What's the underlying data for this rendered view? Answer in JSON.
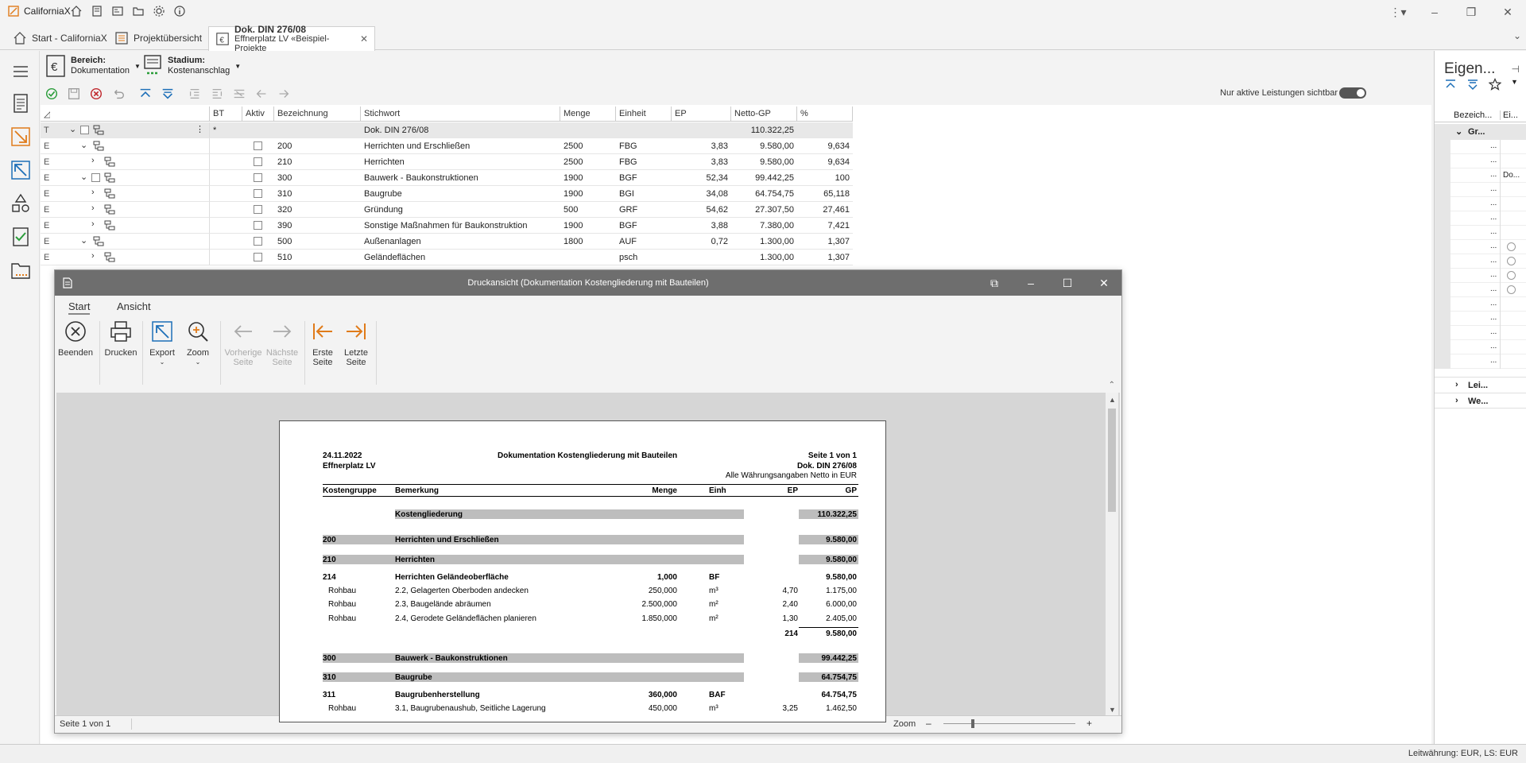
{
  "app": {
    "title": "CaliforniaX",
    "tabs": [
      {
        "label": "Start - CaliforniaX"
      },
      {
        "label": "Projektübersicht"
      },
      {
        "title": "Dok. DIN 276/08",
        "subtitle": "Effnerplatz LV «Beispiel-Projekte"
      }
    ]
  },
  "ribbon": {
    "bereich_label": "Bereich:",
    "bereich_value": "Dokumentation",
    "stadium_label": "Stadium:",
    "stadium_value": "Kostenanschlag",
    "toggle_label": "Nur aktive Leistungen sichtbar",
    "toggle_on": true
  },
  "grid": {
    "headers": [
      "BT",
      "Aktiv",
      "Bezeichnung",
      "Stichwort",
      "Menge",
      "Einheit",
      "EP",
      "Netto-GP",
      "%"
    ],
    "rows": [
      {
        "type": "T",
        "bt": "*",
        "bez": "",
        "stich": "Dok. DIN 276/08",
        "menge": "",
        "einheit": "",
        "ep": "",
        "netto": "110.322,25",
        "pct": ""
      },
      {
        "type": "E",
        "bt": "",
        "bez": "200",
        "stich": "Herrichten und Erschließen",
        "menge": "2500",
        "einheit": "FBG",
        "ep": "3,83",
        "netto": "9.580,00",
        "pct": "9,634"
      },
      {
        "type": "E",
        "bt": "",
        "bez": "210",
        "stich": "Herrichten",
        "menge": "2500",
        "einheit": "FBG",
        "ep": "3,83",
        "netto": "9.580,00",
        "pct": "9,634"
      },
      {
        "type": "E",
        "bt": "",
        "bez": "300",
        "stich": "Bauwerk - Baukonstruktionen",
        "menge": "1900",
        "einheit": "BGF",
        "ep": "52,34",
        "netto": "99.442,25",
        "pct": "100"
      },
      {
        "type": "E",
        "bt": "",
        "bez": "310",
        "stich": "Baugrube",
        "menge": "1900",
        "einheit": "BGI",
        "ep": "34,08",
        "netto": "64.754,75",
        "pct": "65,118"
      },
      {
        "type": "E",
        "bt": "",
        "bez": "320",
        "stich": "Gründung",
        "menge": "500",
        "einheit": "GRF",
        "ep": "54,62",
        "netto": "27.307,50",
        "pct": "27,461"
      },
      {
        "type": "E",
        "bt": "",
        "bez": "390",
        "stich": "Sonstige Maßnahmen für Baukonstruktion",
        "menge": "1900",
        "einheit": "BGF",
        "ep": "3,88",
        "netto": "7.380,00",
        "pct": "7,421"
      },
      {
        "type": "E",
        "bt": "",
        "bez": "500",
        "stich": "Außenanlagen",
        "menge": "1800",
        "einheit": "AUF",
        "ep": "0,72",
        "netto": "1.300,00",
        "pct": "1,307"
      },
      {
        "type": "E",
        "bt": "",
        "bez": "510",
        "stich": "Geländeflächen",
        "menge": "",
        "einheit": "psch",
        "ep": "",
        "netto": "1.300,00",
        "pct": "1,307"
      }
    ]
  },
  "right_panel": {
    "title": "Eigen...",
    "col1": "Bezeich...",
    "col2": "Ei...",
    "group": "Gr...",
    "item_do": "Do...",
    "group2": "Lei...",
    "group3": "We...",
    "dots": "..."
  },
  "dialog": {
    "title": "Druckansicht (Dokumentation Kostengliederung mit Bauteilen)",
    "tabs": [
      "Start",
      "Ansicht"
    ],
    "buttons": {
      "beenden": "Beenden",
      "drucken": "Drucken",
      "export": "Export",
      "zoom": "Zoom",
      "vorherige1": "Vorherige",
      "vorherige2": "Seite",
      "naechste1": "Nächste",
      "naechste2": "Seite",
      "erste1": "Erste",
      "erste2": "Seite",
      "letzte1": "Letzte",
      "letzte2": "Seite"
    },
    "status_page": "Seite 1 von 1",
    "status_zoom": "Zoom"
  },
  "report": {
    "date": "24.11.2022",
    "project": "Effnerplatz LV",
    "title": "Dokumentation Kostengliederung mit Bauteilen",
    "page": "Seite 1 von 1",
    "doc": "Dok. DIN 276/08",
    "currency_note": "Alle Währungsangaben Netto in EUR",
    "headers": {
      "kg": "Kostengruppe",
      "bem": "Bemerkung",
      "menge": "Menge",
      "einh": "Einh",
      "ep": "EP",
      "gp": "GP"
    },
    "rows": [
      {
        "kind": "group",
        "kg": "",
        "bem": "Kostengliederung",
        "menge": "",
        "einh": "",
        "ep": "",
        "gp": "110.322,25"
      },
      {
        "kind": "group",
        "kg": "200",
        "bem": "Herrichten und Erschließen",
        "menge": "",
        "einh": "",
        "ep": "",
        "gp": "9.580,00"
      },
      {
        "kind": "group",
        "kg": "210",
        "bem": "Herrichten",
        "menge": "",
        "einh": "",
        "ep": "",
        "gp": "9.580,00"
      },
      {
        "kind": "head",
        "kg": "214",
        "bem": "Herrichten Geländeoberfläche",
        "menge": "1,000",
        "einh": "BF",
        "ep": "",
        "gp": "9.580,00"
      },
      {
        "kind": "item",
        "kg": "Rohbau",
        "bem": "2.2, Gelagerten Oberboden andecken",
        "menge": "250,000",
        "einh": "m³",
        "ep": "4,70",
        "gp": "1.175,00"
      },
      {
        "kind": "item",
        "kg": "Rohbau",
        "bem": "2.3, Baugelände abräumen",
        "menge": "2.500,000",
        "einh": "m²",
        "ep": "2,40",
        "gp": "6.000,00"
      },
      {
        "kind": "item",
        "kg": "Rohbau",
        "bem": "2.4, Gerodete Geländeflächen planieren",
        "menge": "1.850,000",
        "einh": "m²",
        "ep": "1,30",
        "gp": "2.405,00"
      },
      {
        "kind": "sum",
        "kg": "",
        "bem": "",
        "menge": "",
        "einh": "",
        "ep": "214",
        "gp": "9.580,00"
      },
      {
        "kind": "group",
        "kg": "300",
        "bem": "Bauwerk - Baukonstruktionen",
        "menge": "",
        "einh": "",
        "ep": "",
        "gp": "99.442,25"
      },
      {
        "kind": "group",
        "kg": "310",
        "bem": "Baugrube",
        "menge": "",
        "einh": "",
        "ep": "",
        "gp": "64.754,75"
      },
      {
        "kind": "head",
        "kg": "311",
        "bem": "Baugrubenherstellung",
        "menge": "360,000",
        "einh": "BAF",
        "ep": "",
        "gp": "64.754,75"
      },
      {
        "kind": "item",
        "kg": "Rohbau",
        "bem": "3.1, Baugrubenaushub, Seitliche Lagerung",
        "menge": "450,000",
        "einh": "m³",
        "ep": "3,25",
        "gp": "1.462,50"
      }
    ]
  },
  "statusbar": {
    "text": "Leitwährung: EUR, LS: EUR"
  }
}
